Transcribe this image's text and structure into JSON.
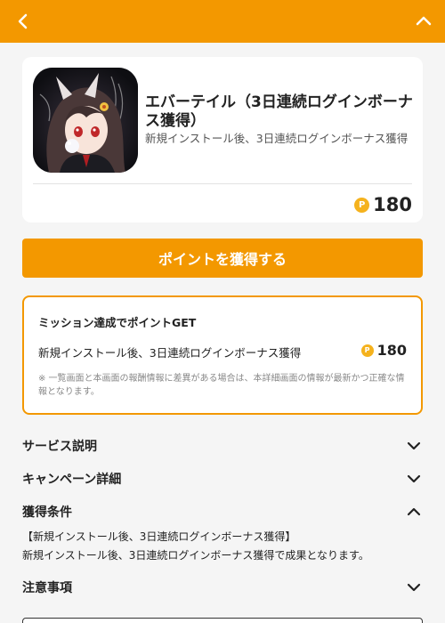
{
  "header": {
    "back_icon": "chevron-left-icon",
    "collapse_icon": "chevron-up-icon",
    "bar_color": "#f39800"
  },
  "offer": {
    "title": "エバーテイル（3日連続ログインボーナス獲得）",
    "subtitle": "新規インストール後、3日連続ログインボーナス獲得",
    "points": "180",
    "coin_symbol": "P"
  },
  "cta": {
    "label": "ポイントを獲得する"
  },
  "mission": {
    "title": "ミッション達成でポイントGET",
    "item_label": "新規インストール後、3日連続ログインボーナス獲得",
    "item_points": "180",
    "note": "※ 一覧画面と本画面の報酬情報に差異がある場合は、本詳細画面の情報が最新かつ正確な情報となります。"
  },
  "sections": {
    "service": "サービス説明",
    "campaign": "キャンペーン詳細",
    "conditions": "獲得条件",
    "notes": "注意事項"
  },
  "conditions": {
    "line1": "【新規インストール後、3日連続ログインボーナス獲得】",
    "line2": "新規インストール後、3日連続ログインボーナス獲得で成果となります。"
  }
}
